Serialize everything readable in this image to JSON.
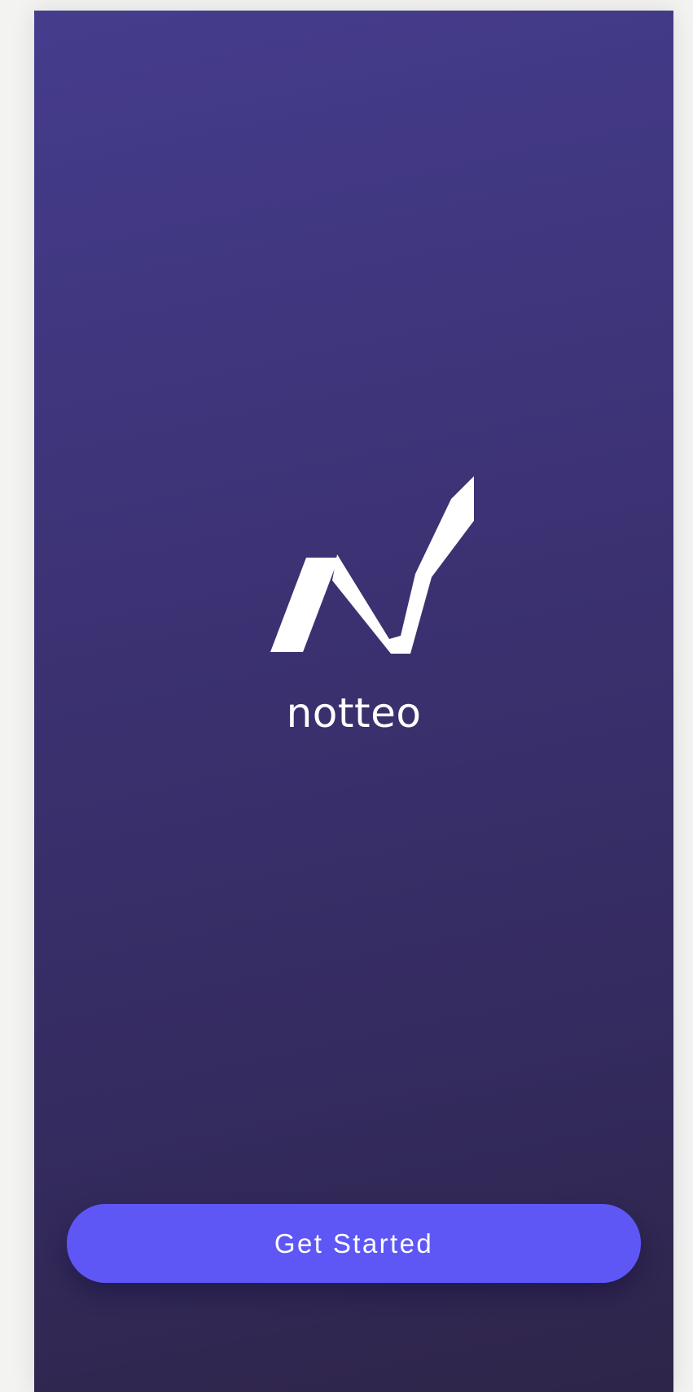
{
  "app": {
    "brand_name": "notteo",
    "logo_icon": "checkmark-n-logo-icon"
  },
  "actions": {
    "get_started_label": "Get Started"
  },
  "colors": {
    "background_top": "#453c8d",
    "background_bottom": "#2e2549",
    "button": "#5e57f6",
    "logo": "#ffffff",
    "text": "#ffffff"
  }
}
